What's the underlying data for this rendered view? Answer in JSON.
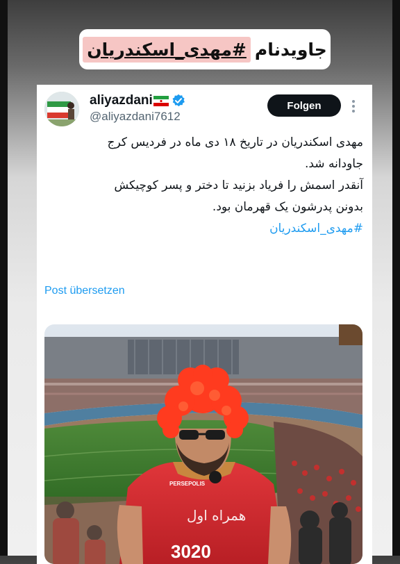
{
  "story": {
    "hashtag_prefix": "جاویدنام",
    "hashtag": "#مهدی_اسکندریان"
  },
  "tweet": {
    "display_name": "aliyazdani",
    "handle": "@aliyazdani7612",
    "follow_label": "Folgen",
    "lines": [
      "مهدی اسکندریان در تاریخ ۱۸ دی ماه در فردیس کرج",
      "جاودانه شد.",
      "آنقدر اسمش را فریاد بزنید تا دختر و پسر کوچیکش",
      "بدونن پدرشون یک قهرمان بود."
    ],
    "hashtag": "#مهدی_اسکندریان",
    "translate_label": "Post übersetzen"
  },
  "shirt": {
    "brand_text": "PERSEPOLIS",
    "sponsor_text": "همراه اول",
    "number_text": "3020"
  },
  "colors": {
    "link_blue": "#1d9bf0",
    "follow_bg": "#0f1419",
    "highlight_pink": "#f6c6c4",
    "jersey_red": "#d42b2b",
    "wig_red": "#ff3b1f"
  },
  "icons": [
    "verified-badge-icon",
    "iran-flag-icon",
    "more-options-icon"
  ]
}
